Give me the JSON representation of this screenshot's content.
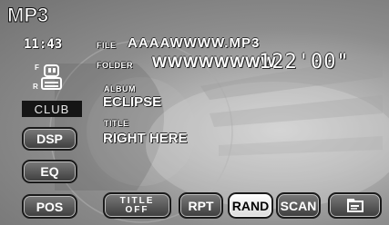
{
  "header": {
    "title": "MP3"
  },
  "status": {
    "clock": "11:43",
    "f_label": "F",
    "r_label": "R",
    "eq_mode": "CLUB"
  },
  "track": {
    "file_label": "FILE",
    "file_name": "AAAAWWWW.MP3",
    "folder_label": "FOLDER",
    "folder_name": "WWWWWWWW",
    "elapsed_time": "122'00\"",
    "album_label": "ALBUM",
    "album_name": "ECLIPSE",
    "title_label": "TITLE",
    "title_name": "RIGHT HERE"
  },
  "side_buttons": {
    "dsp": "DSP",
    "eq": "EQ",
    "pos": "POS"
  },
  "bottom_buttons": {
    "title_off_line1": "TITLE",
    "title_off_line2": "OFF",
    "rpt": "RPT",
    "rand": "RAND",
    "scan": "SCAN"
  },
  "icons": {
    "fader_icon": "fader-balance-icon",
    "folder_back_icon": "folder-return-icon"
  },
  "state": {
    "active_button": "RAND"
  }
}
